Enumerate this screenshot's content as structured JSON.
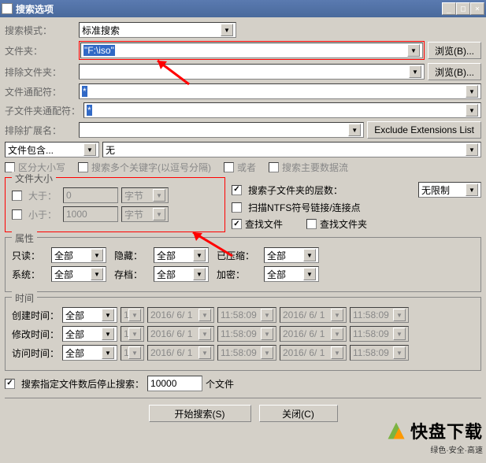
{
  "window": {
    "title": "搜索选项",
    "min": "_",
    "max": "□",
    "close": "×"
  },
  "labels": {
    "search_mode": "搜索模式：",
    "folder": "文件夹：",
    "exclude_folder": "排除文件夹：",
    "file_wildcard": "文件通配符：",
    "subfolder_wildcard": "子文件夹通配符：",
    "exclude_ext": "排除扩展名：",
    "file_contains": "文件包含...",
    "case_sensitive": "区分大小写",
    "multi_keyword": "搜索多个关键字(以逗号分隔)",
    "or": "或者",
    "main_stream": "搜索主要数据流",
    "file_size": "文件大小",
    "greater": "大于：",
    "less": "小于：",
    "byte": "字节",
    "search_sub_depth": "搜索子文件夹的层数：",
    "unlimited": "无限制",
    "scan_ntfs": "扫描NTFS符号链接/连接点",
    "find_files": "查找文件",
    "find_folders": "查找文件夹",
    "attributes": "属性",
    "readonly": "只读：",
    "hidden": "隐藏：",
    "compressed": "已压缩：",
    "system": "系统：",
    "archive": "存档：",
    "encrypted": "加密：",
    "all": "全部",
    "time": "时间",
    "ctime": "创建时间：",
    "mtime": "修改时间：",
    "atime": "访问时间：",
    "stop_after": "搜索指定文件数后停止搜索：",
    "files_unit": "个文件",
    "start_search": "开始搜索(S)",
    "close_btn": "关闭(C)",
    "browse": "浏览(B)...",
    "none": "无",
    "excl_list": "Exclude Extensions List"
  },
  "values": {
    "search_mode": "标准搜索",
    "folder_path": "\"F:\\iso\"",
    "wildcard": "*",
    "gt": "0",
    "lt": "1000",
    "stop_count": "10000",
    "date": "2016/ 6/ 1",
    "time_v": "11:58:09",
    "one": "1"
  },
  "watermark": {
    "name": "快盘下载",
    "sub": "绿色·安全·高速"
  }
}
